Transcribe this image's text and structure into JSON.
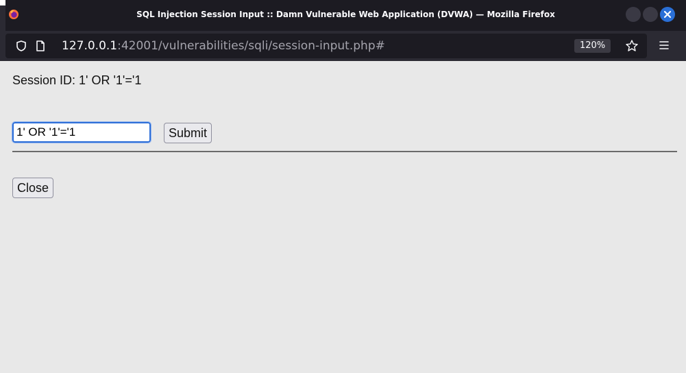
{
  "window": {
    "title": "SQL Injection Session Input :: Damn Vulnerable Web Application (DVWA) — Mozilla Firefox"
  },
  "urlbar": {
    "host": "127.0.0.1",
    "rest": ":42001/vulnerabilities/sqli/session-input.php#",
    "zoom": "120%"
  },
  "page": {
    "session_label": "Session ID: 1' OR '1'='1",
    "input_value": "1' OR '1'='1",
    "submit_label": "Submit",
    "close_label": "Close"
  },
  "icons": {
    "browser_logo": "firefox-logo-icon",
    "tracking": "shield-icon",
    "page": "page-icon",
    "bookmark": "star-icon",
    "menu": "hamburger-menu-icon",
    "window_close": "close-icon"
  },
  "colors": {
    "titlebar": "#1c1b22",
    "toolbar": "#2b2a33",
    "content_bg": "#e8e8e8",
    "focus_ring": "#2f6fd8",
    "window_close_button": "#2a6fd6"
  }
}
